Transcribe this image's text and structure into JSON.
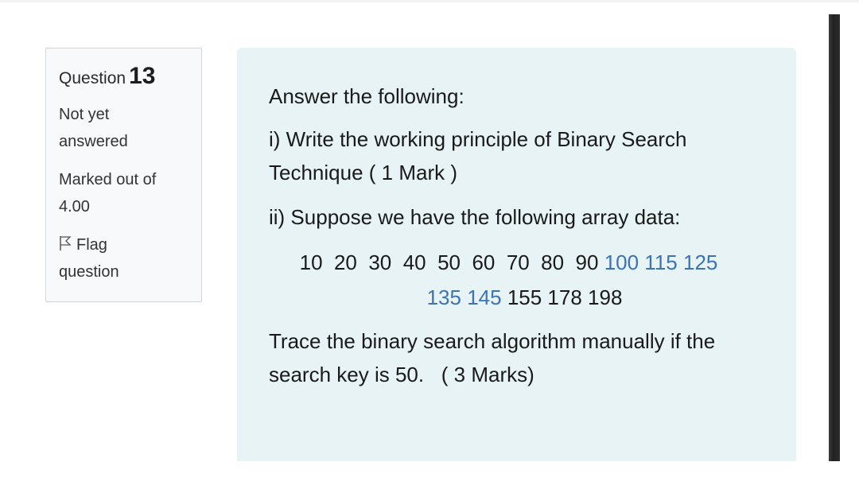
{
  "question_info": {
    "label": "Question",
    "number": "13",
    "state": "Not yet answered",
    "grade": "Marked out of 4.00",
    "flag_label": "Flag question"
  },
  "question": {
    "intro": "Answer the following:",
    "part1": "i) Write the working principle of Binary Search Technique   ( 1 Mark )",
    "part2": "ii) Suppose we have the following array data:",
    "array_line1_black": "10  20  30  40  50  60  70  80  90",
    "array_line1_blue": "100 115 125",
    "array_line2_blue": "135 145",
    "array_line2_black": "155 178 198",
    "part3": "Trace the binary search algorithm manually if the search key is 50.   ( 3 Marks)"
  },
  "colors": {
    "info_bg": "#f8f9fa",
    "content_bg": "#e7f3f5",
    "link_blue": "#3b73b5"
  }
}
